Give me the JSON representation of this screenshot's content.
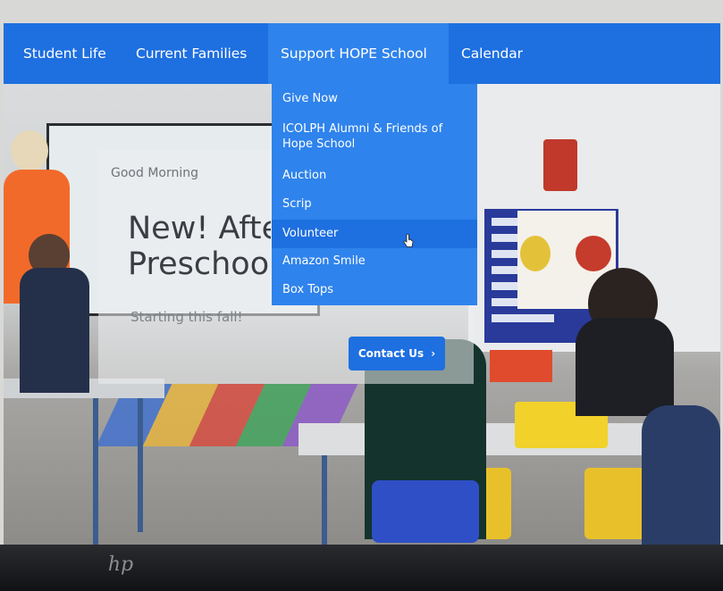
{
  "nav": {
    "items": [
      {
        "label": "Student Life"
      },
      {
        "label": "Current Families"
      },
      {
        "label": "Support HOPE School",
        "active": true
      },
      {
        "label": "Calendar"
      }
    ]
  },
  "dropdown": {
    "items": [
      {
        "label": "Give Now"
      },
      {
        "label": "ICOLPH Alumni & Friends of Hope School"
      },
      {
        "label": "Auction"
      },
      {
        "label": "Scrip"
      },
      {
        "label": "Volunteer",
        "hovered": true
      },
      {
        "label": "Amazon Smile"
      },
      {
        "label": "Box Tops"
      }
    ]
  },
  "hero": {
    "greeting": "Good Morning",
    "title_line1": "New! Afte",
    "title_line2": "Preschoo",
    "subtitle": "Starting this fall!",
    "cta_label": "Contact Us",
    "cta_icon": "chevron-right-icon"
  },
  "bezel": {
    "logo": "hp"
  },
  "colors": {
    "nav_bg": "#1e6fe0",
    "dropdown_bg": "#2f83ec",
    "dropdown_hover": "#1e6fe0",
    "cta_bg": "#1e6fe0"
  }
}
